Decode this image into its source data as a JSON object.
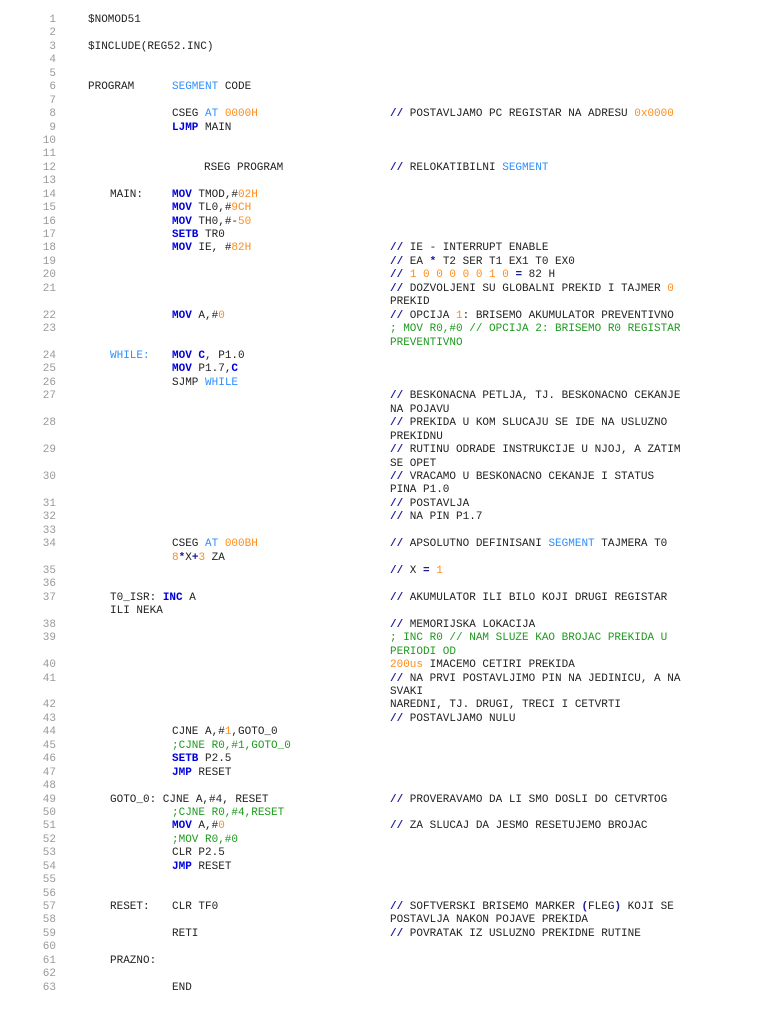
{
  "colors": {
    "keyword": "#0000dd",
    "directive": "#2f8fff",
    "number": "#ff8c1a",
    "comment_green": "#1e9a1e",
    "comment_slash": "#1a1a9a",
    "line_number": "#999999"
  },
  "lines": [
    {
      "n": "1",
      "top": [
        "$NOMOD51"
      ]
    },
    {
      "n": "2"
    },
    {
      "n": "3",
      "top": [
        "$INCLUDE(REG52.INC)"
      ]
    },
    {
      "n": "4"
    },
    {
      "n": "5"
    },
    {
      "n": "6",
      "top": [
        "PROGRAM"
      ],
      "ins": [
        [
          "SEGMENT",
          "b"
        ],
        " CODE"
      ]
    },
    {
      "n": "7"
    },
    {
      "n": "8",
      "ins": [
        "CSEG ",
        [
          "AT",
          "b"
        ],
        " ",
        [
          "0000H",
          "o"
        ]
      ],
      "com": [
        [
          [
            "//",
            "c"
          ],
          " POSTAVLJAMO PC REGISTAR NA ADRESU ",
          [
            "0x0000",
            "o"
          ]
        ]
      ]
    },
    {
      "n": "9",
      "ins": [
        [
          "LJMP",
          "k"
        ],
        " MAIN"
      ]
    },
    {
      "n": "10"
    },
    {
      "n": "11"
    },
    {
      "n": "12",
      "inner": [
        "RSEG PROGRAM"
      ],
      "com": [
        [
          [
            "//",
            "c"
          ],
          " RELOKATIBILNI ",
          [
            "SEGMENT",
            "b"
          ]
        ]
      ]
    },
    {
      "n": "13"
    },
    {
      "n": "14",
      "label": [
        "MAIN:"
      ],
      "ins": [
        [
          "MOV",
          "k"
        ],
        " TMOD,#",
        [
          "02H",
          "o"
        ]
      ]
    },
    {
      "n": "15",
      "ins": [
        [
          "MOV",
          "k"
        ],
        " TL0,#",
        [
          "9CH",
          "o"
        ]
      ]
    },
    {
      "n": "16",
      "ins": [
        [
          "MOV",
          "k"
        ],
        " TH0,#-",
        [
          "50",
          "o"
        ]
      ]
    },
    {
      "n": "17",
      "ins": [
        [
          "SETB",
          "k"
        ],
        " TR0"
      ]
    },
    {
      "n": "18",
      "ins": [
        [
          "MOV",
          "k"
        ],
        " IE, #",
        [
          "82H",
          "o"
        ]
      ],
      "com": [
        [
          [
            "//",
            "c"
          ],
          " IE - INTERRUPT ENABLE"
        ]
      ]
    },
    {
      "n": "19",
      "com": [
        [
          [
            "//",
            "c"
          ],
          " EA ",
          [
            "*",
            "c"
          ],
          " T2 SER T1 EX1 T0 EX0"
        ]
      ]
    },
    {
      "n": "20",
      "com": [
        [
          [
            "//",
            "c"
          ],
          " ",
          [
            "1 0 0 0 0 0 1 0",
            "o"
          ],
          " ",
          [
            "=",
            "c"
          ],
          " 82 H"
        ]
      ]
    },
    {
      "n": "21",
      "com": [
        [
          [
            "//",
            "c"
          ],
          " DOZVOLJENI SU GLOBALNI PREKID I TAJMER ",
          [
            "0",
            "o"
          ]
        ],
        [
          "PREKID"
        ]
      ]
    },
    {
      "n": "22",
      "ins": [
        [
          "MOV",
          "k"
        ],
        " A,#",
        [
          "0",
          "o"
        ]
      ],
      "com": [
        [
          [
            "//",
            "c"
          ],
          " OPCIJA ",
          [
            "1",
            "o"
          ],
          ": BRISEMO AKUMULATOR PREVENTIVNO"
        ]
      ]
    },
    {
      "n": "23",
      "com": [
        [
          [
            "; MOV R0,#0 // OPCIJA 2: BRISEMO R0 REGISTAR",
            "g"
          ]
        ],
        [
          [
            "PREVENTIVNO",
            "g"
          ]
        ]
      ]
    },
    {
      "n": "24",
      "label": [
        [
          "WHILE:",
          "b"
        ]
      ],
      "ins": [
        [
          "MOV",
          "k"
        ],
        " ",
        [
          "C",
          "k"
        ],
        ", P1.0"
      ]
    },
    {
      "n": "25",
      "ins": [
        [
          "MOV",
          "k"
        ],
        " P1.7,",
        [
          "C",
          "k"
        ]
      ]
    },
    {
      "n": "26",
      "ins": [
        "SJMP ",
        [
          "WHILE",
          "b"
        ]
      ]
    },
    {
      "n": "27",
      "com": [
        [
          [
            "//",
            "c"
          ],
          " BESKONACNA PETLJA, TJ. BESKONACNO CEKANJE"
        ],
        [
          "NA POJAVU"
        ]
      ]
    },
    {
      "n": "28",
      "com": [
        [
          [
            "//",
            "c"
          ],
          " PREKIDA U KOM SLUCAJU SE IDE NA USLUZNO"
        ],
        [
          "PREKIDNU"
        ]
      ]
    },
    {
      "n": "29",
      "com": [
        [
          [
            "//",
            "c"
          ],
          " RUTINU ODRADE INSTRUKCIJE U NJOJ, A ZATIM"
        ],
        [
          "SE OPET"
        ]
      ]
    },
    {
      "n": "30",
      "com": [
        [
          [
            "//",
            "c"
          ],
          " VRACAMO U BESKONACNO CEKANJE I STATUS"
        ],
        [
          "PINA P1.0"
        ]
      ]
    },
    {
      "n": "31",
      "com": [
        [
          [
            "//",
            "c"
          ],
          " POSTAVLJA"
        ]
      ]
    },
    {
      "n": "32",
      "com": [
        [
          [
            "//",
            "c"
          ],
          " NA PIN P1.7"
        ]
      ]
    },
    {
      "n": "33"
    },
    {
      "n": "34",
      "ins": [
        "CSEG ",
        [
          "AT",
          "b"
        ],
        " ",
        [
          "000BH",
          "o"
        ]
      ],
      "insWrap": [
        [
          "8",
          "o"
        ],
        [
          "*",
          "c"
        ],
        "X",
        [
          "+",
          "c"
        ],
        [
          "3",
          "o"
        ],
        " ZA"
      ],
      "com": [
        [
          [
            "//",
            "c"
          ],
          " APSOLUTNO DEFINISANI ",
          [
            "SEGMENT",
            "b"
          ],
          " TAJMERA T0"
        ]
      ]
    },
    {
      "n": "35",
      "com": [
        [
          [
            "//",
            "c"
          ],
          " X ",
          [
            "=",
            "c"
          ],
          " ",
          [
            "1",
            "o"
          ]
        ]
      ]
    },
    {
      "n": "36"
    },
    {
      "n": "37",
      "label": [
        "T0_ISR: ",
        [
          "INC",
          "k"
        ],
        " A"
      ],
      "labelWrap": [
        "ILI NEKA"
      ],
      "com": [
        [
          [
            "//",
            "c"
          ],
          " AKUMULATOR ILI BILO KOJI DRUGI REGISTAR"
        ]
      ]
    },
    {
      "n": "38",
      "com": [
        [
          [
            "//",
            "c"
          ],
          " MEMORIJSKA LOKACIJA"
        ]
      ]
    },
    {
      "n": "39",
      "com": [
        [
          [
            "; INC R0 // NAM SLUZE KAO BROJAC PREKIDA U",
            "g"
          ]
        ],
        [
          [
            "PERIODI OD",
            "g"
          ]
        ]
      ]
    },
    {
      "n": "40",
      "com": [
        [
          [
            "200us",
            "o"
          ],
          " IMACEMO CETIRI PREKIDA"
        ]
      ]
    },
    {
      "n": "41",
      "com": [
        [
          [
            "//",
            "c"
          ],
          " NA PRVI POSTAVLJIMO PIN NA JEDINICU, A NA"
        ],
        [
          "SVAKI"
        ]
      ]
    },
    {
      "n": "42",
      "com": [
        [
          "NAREDNI, TJ. DRUGI, TRECI I CETVRTI"
        ]
      ]
    },
    {
      "n": "43",
      "com": [
        [
          [
            "//",
            "c"
          ],
          " POSTAVLJAMO NULU"
        ]
      ]
    },
    {
      "n": "44",
      "ins": [
        "CJNE A,#",
        [
          "1",
          "o"
        ],
        ",GOTO_0"
      ]
    },
    {
      "n": "45",
      "ins": [
        [
          ";CJNE R0,#1,GOTO_0",
          "g"
        ]
      ]
    },
    {
      "n": "46",
      "ins": [
        [
          "SETB",
          "k"
        ],
        " P2.5"
      ]
    },
    {
      "n": "47",
      "ins": [
        [
          "JMP",
          "k"
        ],
        " RESET"
      ]
    },
    {
      "n": "48"
    },
    {
      "n": "49",
      "label": [
        "GOTO_0: CJNE A,#4, RESET"
      ],
      "com": [
        [
          [
            "//",
            "c"
          ],
          " PROVERAVAMO DA LI SMO DOSLI DO CETVRTOG"
        ]
      ]
    },
    {
      "n": "50",
      "ins": [
        [
          ";CJNE R0,#4,RESET",
          "g"
        ]
      ]
    },
    {
      "n": "51",
      "ins": [
        [
          "MOV",
          "k"
        ],
        " A,#",
        [
          "0",
          "o"
        ]
      ],
      "com": [
        [
          [
            "//",
            "c"
          ],
          " ZA SLUCAJ DA JESMO RESETUJEMO BROJAC"
        ]
      ]
    },
    {
      "n": "52",
      "ins": [
        [
          ";MOV R0,#0",
          "g"
        ]
      ]
    },
    {
      "n": "53",
      "ins": [
        "CLR P2.5"
      ]
    },
    {
      "n": "54",
      "ins": [
        [
          "JMP",
          "k"
        ],
        " RESET"
      ]
    },
    {
      "n": "55"
    },
    {
      "n": "56"
    },
    {
      "n": "57",
      "label": [
        "RESET:"
      ],
      "ins": [
        "CLR TF0"
      ],
      "com": [
        [
          [
            "//",
            "c"
          ],
          " SOFTVERSKI BRISEMO MARKER ",
          [
            "(",
            "c"
          ],
          "FLEG",
          [
            ")",
            "c"
          ],
          " KOJI SE"
        ]
      ]
    },
    {
      "n": "58",
      "com": [
        [
          "POSTAVLJA NAKON POJAVE PREKIDA"
        ]
      ]
    },
    {
      "n": "59",
      "ins": [
        "RETI"
      ],
      "com": [
        [
          [
            "//",
            "c"
          ],
          " POVRATAK IZ USLUZNO PREKIDNE RUTINE"
        ]
      ]
    },
    {
      "n": "60"
    },
    {
      "n": "61",
      "label": [
        "PRAZNO:"
      ]
    },
    {
      "n": "62"
    },
    {
      "n": "63",
      "ins": [
        "END"
      ]
    }
  ]
}
